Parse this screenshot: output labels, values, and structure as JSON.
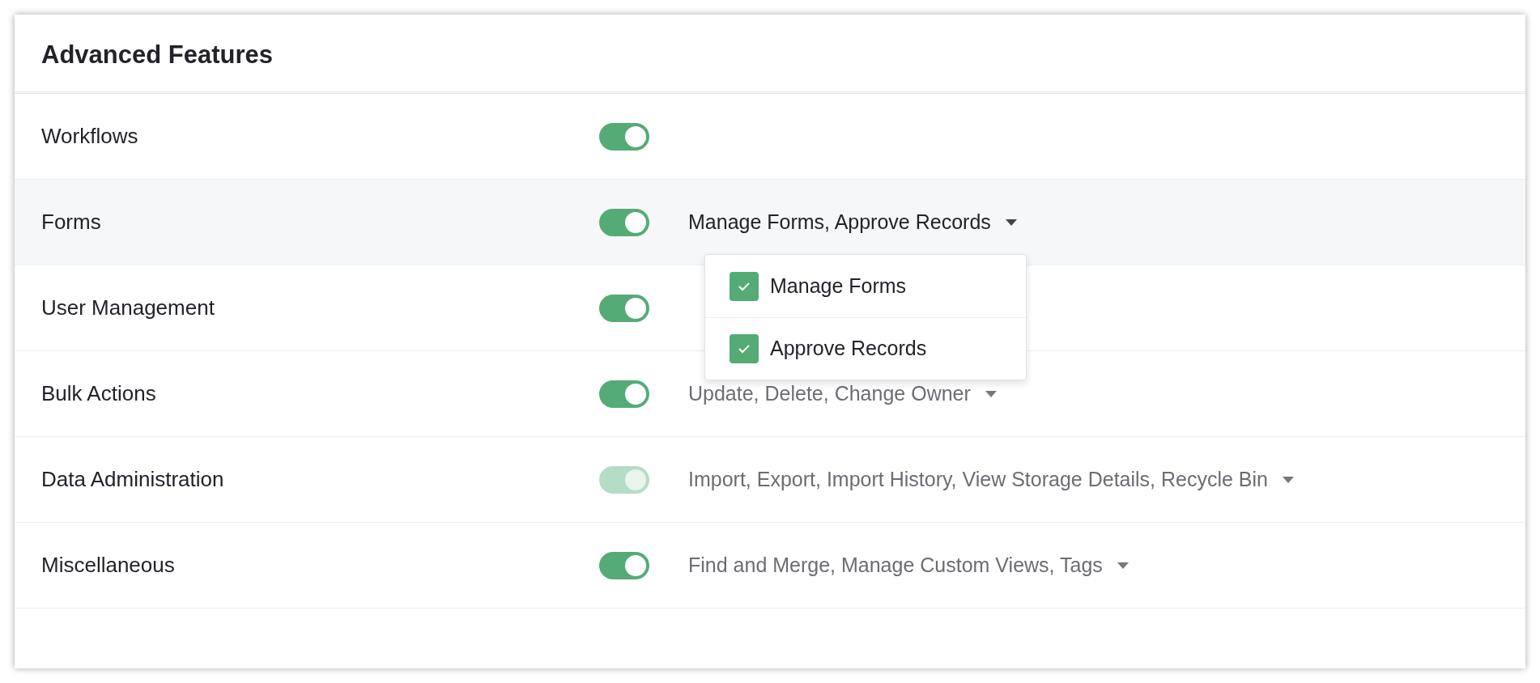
{
  "panel": {
    "title": "Advanced Features"
  },
  "rows": [
    {
      "label": "Workflows",
      "on": true,
      "disabled": false,
      "expanded": false
    },
    {
      "label": "Forms",
      "on": true,
      "disabled": false,
      "expanded": true,
      "summary": "Manage Forms, Approve Records",
      "options": [
        {
          "label": "Manage Forms",
          "checked": true
        },
        {
          "label": "Approve Records",
          "checked": true
        }
      ]
    },
    {
      "label": "User Management",
      "on": true,
      "disabled": false,
      "expanded": false
    },
    {
      "label": "Bulk Actions",
      "on": true,
      "disabled": false,
      "expanded": false,
      "summary": "Update, Delete, Change Owner"
    },
    {
      "label": "Data Administration",
      "on": true,
      "disabled": true,
      "expanded": false,
      "summary": "Import, Export, Import History, View Storage Details, Recycle Bin"
    },
    {
      "label": "Miscellaneous",
      "on": true,
      "disabled": false,
      "expanded": false,
      "summary": "Find and Merge, Manage Custom Views, Tags"
    }
  ]
}
